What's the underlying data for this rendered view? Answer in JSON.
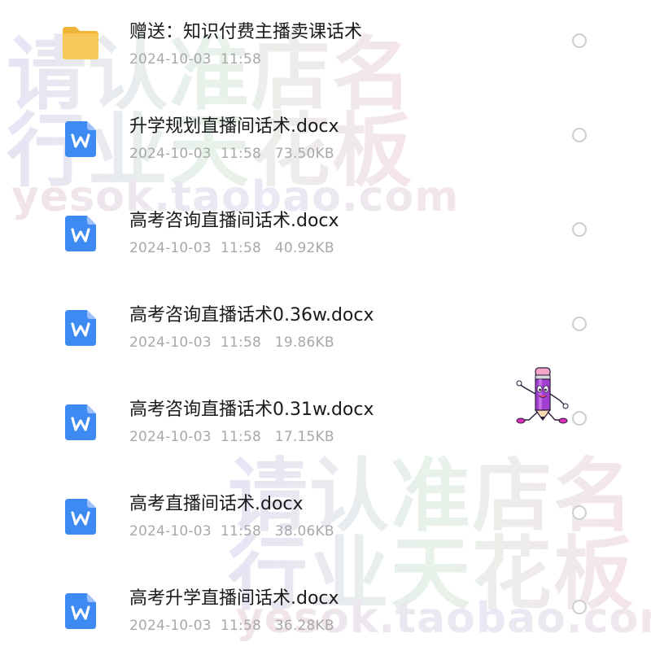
{
  "watermark": {
    "line1": "请认准店名",
    "line2": "行业天花板",
    "line3": "yesok.taobao.com"
  },
  "files": [
    {
      "type": "folder",
      "icon": "folder-icon",
      "name": "赠送：知识付费主播卖课话术",
      "meta": "2024-10-03  11:58"
    },
    {
      "type": "docx",
      "icon": "word-doc-icon",
      "name": "升学规划直播间话术.docx",
      "meta": "2024-10-03  11:58   73.50KB"
    },
    {
      "type": "docx",
      "icon": "word-doc-icon",
      "name": "高考咨询直播间话术.docx",
      "meta": "2024-10-03  11:58   40.92KB"
    },
    {
      "type": "docx",
      "icon": "word-doc-icon",
      "name": "高考咨询直播话术0.36w.docx",
      "meta": "2024-10-03  11:58   19.86KB"
    },
    {
      "type": "docx",
      "icon": "word-doc-icon",
      "name": "高考咨询直播话术0.31w.docx",
      "meta": "2024-10-03  11:58   17.15KB"
    },
    {
      "type": "docx",
      "icon": "word-doc-icon",
      "name": "高考直播间话术.docx",
      "meta": "2024-10-03  11:58   38.06KB"
    },
    {
      "type": "docx",
      "icon": "word-doc-icon",
      "name": "高考升学直播间话术.docx",
      "meta": "2024-10-03  11:58   36.28KB"
    }
  ],
  "colors": {
    "doc_icon": "#3d8bf2",
    "folder_icon": "#f5c04a",
    "name_text": "#1a1a1a",
    "meta_text": "#a8a8a8",
    "radio_border": "#cfcfcf"
  },
  "mascot": {
    "icon": "pencil-mascot-icon"
  }
}
